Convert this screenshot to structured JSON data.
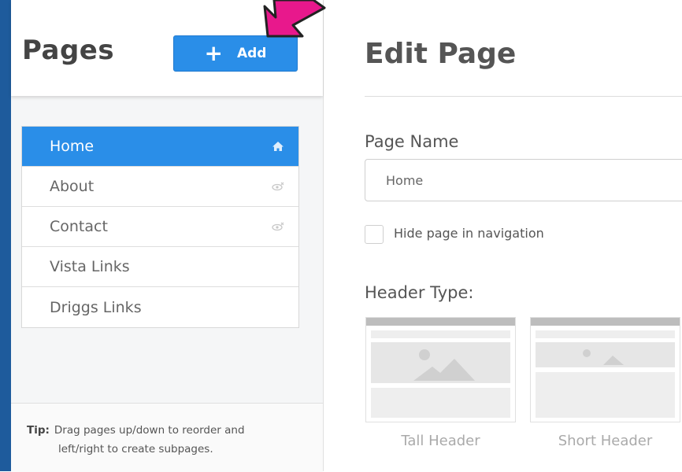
{
  "sidebar": {
    "title": "Pages",
    "add_button_label": "Add",
    "pages": [
      {
        "label": "Home",
        "active": true,
        "icon": "home-icon"
      },
      {
        "label": "About",
        "active": false,
        "icon": "hidden-eye-icon"
      },
      {
        "label": "Contact",
        "active": false,
        "icon": "hidden-eye-icon"
      },
      {
        "label": "Vista Links",
        "active": false,
        "icon": ""
      },
      {
        "label": "Driggs Links",
        "active": false,
        "icon": ""
      }
    ],
    "tip": {
      "label": "Tip:",
      "line1": "Drag pages up/down to reorder and",
      "line2": "left/right to create subpages."
    }
  },
  "main": {
    "heading": "Edit Page",
    "page_name_label": "Page Name",
    "page_name_value": "Home",
    "hide_checkbox_label": "Hide page in navigation",
    "hide_checked": false,
    "header_type_label": "Header Type:",
    "header_options": [
      {
        "label": "Tall Header"
      },
      {
        "label": "Short Header"
      }
    ]
  },
  "colors": {
    "accent": "#2a8ee8",
    "arrow": "#e8188c",
    "left_strip": "#1e5b9c"
  }
}
